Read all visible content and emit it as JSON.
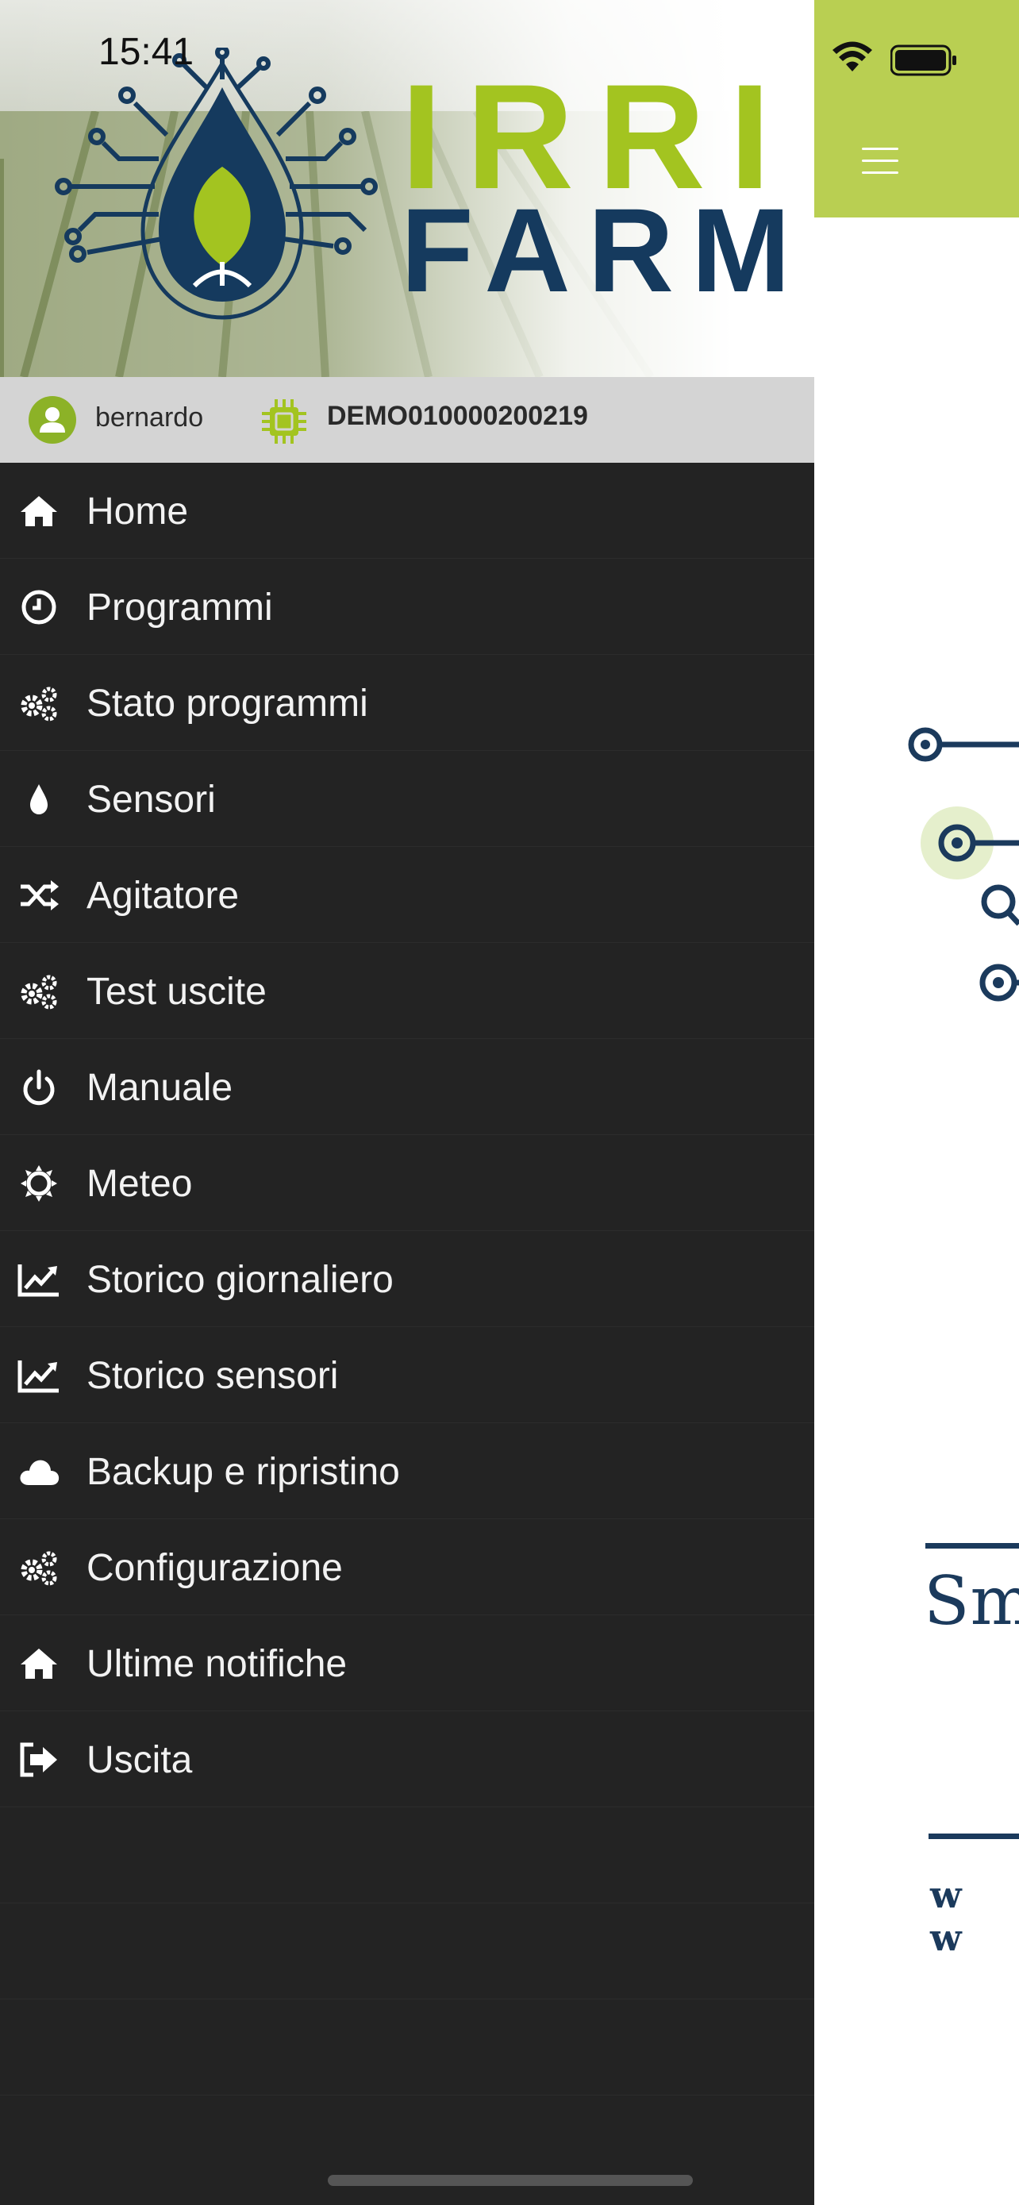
{
  "status_bar": {
    "time": "15:41"
  },
  "brand": {
    "line1": "IRRI",
    "line2": "FARM"
  },
  "user_bar": {
    "username": "bernardo",
    "device_id": "DEMO010000200219"
  },
  "menu": {
    "items": [
      {
        "label": "Home",
        "icon": "home-icon"
      },
      {
        "label": "Programmi",
        "icon": "clock-icon"
      },
      {
        "label": "Stato programmi",
        "icon": "gears-icon"
      },
      {
        "label": "Sensori",
        "icon": "drop-icon"
      },
      {
        "label": "Agitatore",
        "icon": "shuffle-icon"
      },
      {
        "label": "Test uscite",
        "icon": "gears-icon"
      },
      {
        "label": "Manuale",
        "icon": "power-icon"
      },
      {
        "label": "Meteo",
        "icon": "sun-icon"
      },
      {
        "label": "Storico giornaliero",
        "icon": "line-chart-icon"
      },
      {
        "label": "Storico sensori",
        "icon": "line-chart-icon"
      },
      {
        "label": "Backup e ripristino",
        "icon": "cloud-icon"
      },
      {
        "label": "Configurazione",
        "icon": "gears-icon"
      },
      {
        "label": "Ultime notifiche",
        "icon": "home-icon"
      },
      {
        "label": "Uscita",
        "icon": "sign-out-icon"
      }
    ]
  },
  "background_page": {
    "partial_text": "Sm",
    "partial_url": "w w"
  },
  "colors": {
    "accent_green": "#b9cf52",
    "brand_green": "#a3c420",
    "brand_navy": "#153a5e",
    "drawer_bg": "#232323",
    "user_bar_bg": "#d4d4d4"
  }
}
